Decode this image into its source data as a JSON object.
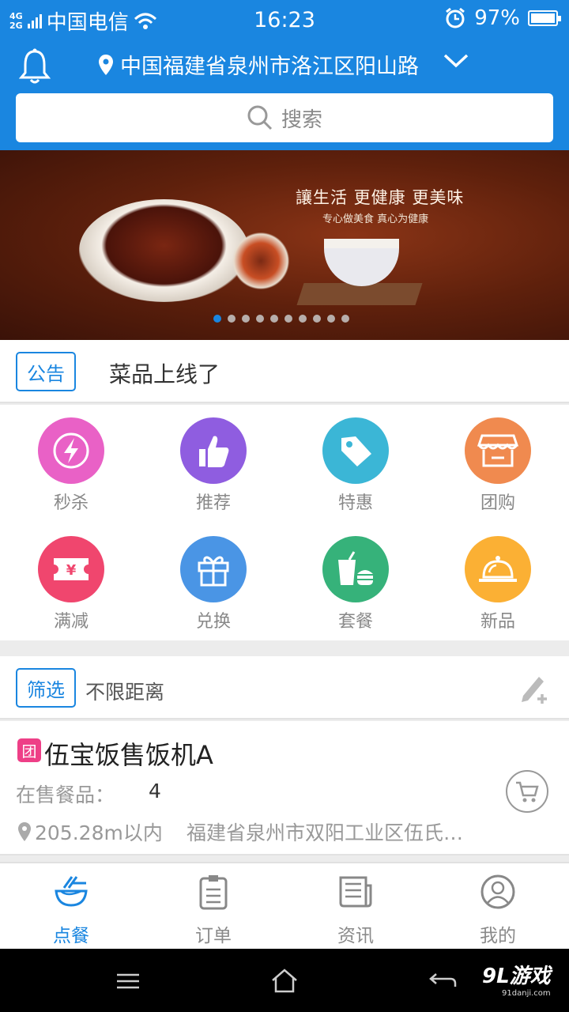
{
  "status_bar": {
    "network": "4G\n2G",
    "carrier": "中国电信",
    "time": "16:23",
    "battery": "97%"
  },
  "header": {
    "location": "中国福建省泉州市洛江区阳山路"
  },
  "search": {
    "placeholder": "搜索"
  },
  "banner": {
    "headline": "讓生活 更健康 更美味",
    "subline": "专心做美食 真心为健康",
    "slide_count": 10,
    "active_slide": 1
  },
  "notice": {
    "tag": "公告",
    "text": "菜品上线了"
  },
  "categories": [
    {
      "label": "秒杀",
      "color": "#e961c6",
      "icon": "lightning-icon"
    },
    {
      "label": "推荐",
      "color": "#8f5de0",
      "icon": "thumbs-up-icon"
    },
    {
      "label": "特惠",
      "color": "#3bb6d6",
      "icon": "price-tag-icon"
    },
    {
      "label": "团购",
      "color": "#f08a4f",
      "icon": "storefront-icon"
    },
    {
      "label": "满减",
      "color": "#f0466e",
      "icon": "coupon-icon"
    },
    {
      "label": "兑换",
      "color": "#4a95e5",
      "icon": "gift-icon"
    },
    {
      "label": "套餐",
      "color": "#36b27a",
      "icon": "combo-meal-icon"
    },
    {
      "label": "新品",
      "color": "#fbb034",
      "icon": "cloche-icon"
    }
  ],
  "filter": {
    "tag": "筛选",
    "text": "不限距离"
  },
  "shop": {
    "badge": "团",
    "name": "伍宝饭售饭机A",
    "sale_label": "在售餐品：",
    "sale_count": "4",
    "distance": "205.28m以内",
    "address": "福建省泉州市双阳工业区伍氏…"
  },
  "tabs": [
    {
      "label": "点餐",
      "icon": "dining-icon",
      "active": true
    },
    {
      "label": "订单",
      "icon": "order-clipboard-icon",
      "active": false
    },
    {
      "label": "资讯",
      "icon": "news-icon",
      "active": false
    },
    {
      "label": "我的",
      "icon": "profile-icon",
      "active": false
    }
  ],
  "watermark": {
    "brand": "9L游戏",
    "site": "91danji.com"
  },
  "colors": {
    "primary": "#1a86e0",
    "badge_pink": "#ee3f87"
  }
}
